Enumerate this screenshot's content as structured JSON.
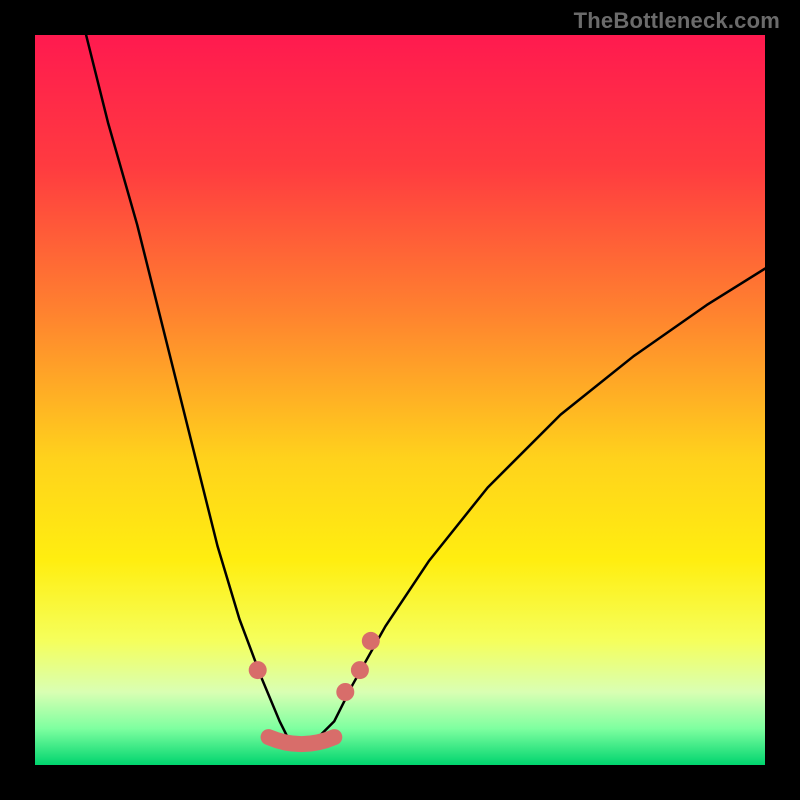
{
  "watermark": {
    "text": "TheBottleneck.com"
  },
  "chart_data": {
    "type": "line",
    "title": "",
    "xlabel": "",
    "ylabel": "",
    "xlim": [
      0,
      100
    ],
    "ylim": [
      0,
      100
    ],
    "legend": {
      "visible": false
    },
    "grid": false,
    "gradient_stops": [
      {
        "pct": 0,
        "color": "#ff1a4f"
      },
      {
        "pct": 18,
        "color": "#ff3b40"
      },
      {
        "pct": 38,
        "color": "#ff822f"
      },
      {
        "pct": 58,
        "color": "#ffd21c"
      },
      {
        "pct": 72,
        "color": "#ffee10"
      },
      {
        "pct": 83,
        "color": "#f5ff5c"
      },
      {
        "pct": 90,
        "color": "#d9ffb3"
      },
      {
        "pct": 95,
        "color": "#7effa0"
      },
      {
        "pct": 100,
        "color": "#00d46e"
      }
    ],
    "series": [
      {
        "name": "bottleneck-curve",
        "x": [
          7,
          10,
          14,
          18,
          22,
          25,
          28,
          31,
          33.5,
          35,
          36.5,
          38,
          41,
          43.5,
          48,
          54,
          62,
          72,
          82,
          92,
          100
        ],
        "y": [
          100,
          88,
          74,
          58,
          42,
          30,
          20,
          12,
          6,
          3,
          2,
          3,
          6,
          11,
          19,
          28,
          38,
          48,
          56,
          63,
          68
        ]
      }
    ],
    "markers": {
      "name": "highlight-dots",
      "color": "#d86d6a",
      "points": [
        {
          "x": 30.5,
          "y": 13,
          "r": 9
        },
        {
          "x": 42.5,
          "y": 10,
          "r": 9
        },
        {
          "x": 44.5,
          "y": 13,
          "r": 9
        },
        {
          "x": 46.0,
          "y": 17,
          "r": 9
        }
      ]
    },
    "valley_band": {
      "name": "valley-band",
      "color": "#d86d6a",
      "x_start": 32,
      "x_end": 41,
      "y": 3,
      "thickness": 16
    }
  }
}
